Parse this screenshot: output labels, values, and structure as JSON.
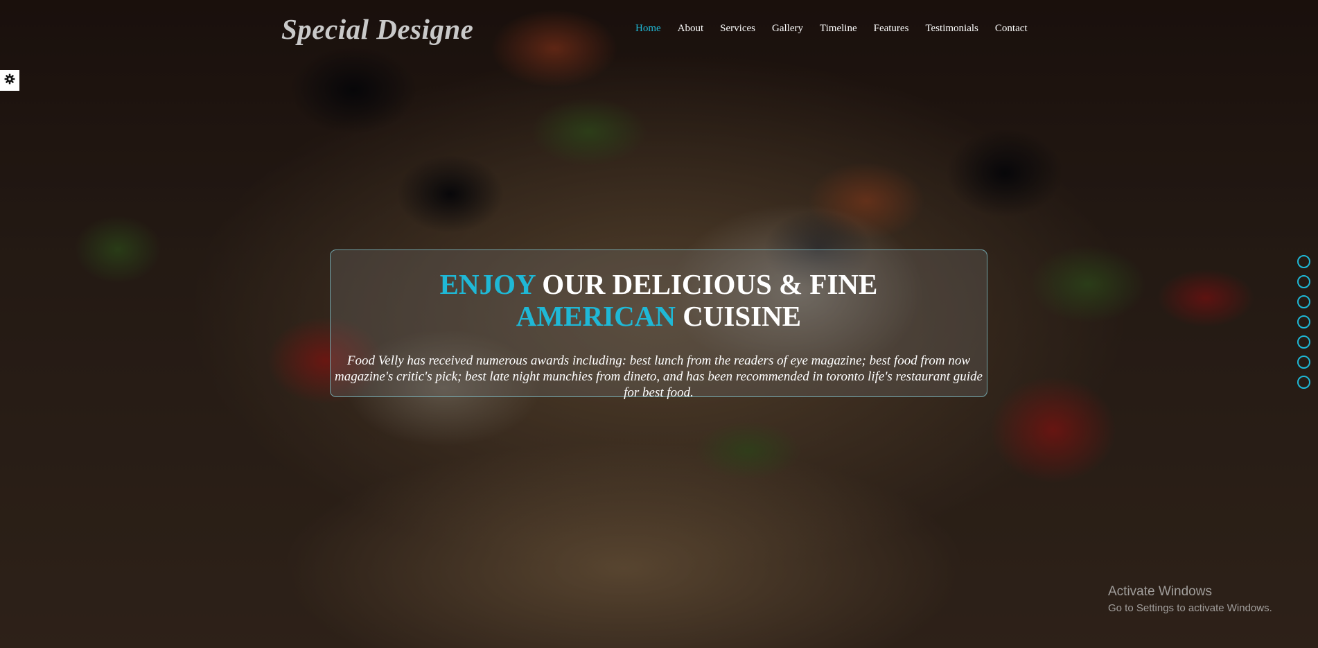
{
  "header": {
    "logo_text": "Special Designe",
    "nav": [
      {
        "label": "Home",
        "active": true
      },
      {
        "label": "About",
        "active": false
      },
      {
        "label": "Services",
        "active": false
      },
      {
        "label": "Gallery",
        "active": false
      },
      {
        "label": "Timeline",
        "active": false
      },
      {
        "label": "Features",
        "active": false
      },
      {
        "label": "Testimonials",
        "active": false
      },
      {
        "label": "Contact",
        "active": false
      }
    ]
  },
  "settings": {
    "icon": "gear-icon"
  },
  "hero": {
    "title_part1": "ENJOY",
    "title_part2": " OUR DELICIOUS & FINE ",
    "title_part3": "AMERICAN",
    "title_part4": " CUISINE",
    "text": "Food Velly has received numerous awards including: best lunch from the readers of eye magazine; best food from now magazine's critic's pick; best late night munchies from dineto, and has been recommended in toronto life's restaurant guide for best food."
  },
  "dot_nav": {
    "count": 7,
    "accent_color": "#1fb8d6"
  },
  "watermark": {
    "title": "Activate Windows",
    "subtitle": "Go to Settings to activate Windows."
  },
  "colors": {
    "accent": "#1fb8d6",
    "text": "#ffffff",
    "logo": "#c9c9c9"
  }
}
